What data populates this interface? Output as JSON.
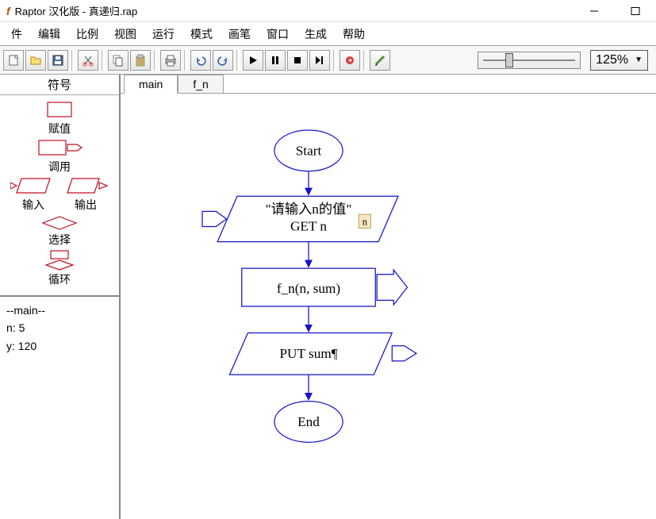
{
  "window": {
    "title": "Raptor 汉化版 - 真递归.rap",
    "logo_text": "f"
  },
  "menubar": {
    "items": [
      "件",
      "编辑",
      "比例",
      "视图",
      "运行",
      "模式",
      "画笔",
      "窗口",
      "生成",
      "帮助"
    ]
  },
  "toolbar": {
    "zoom_value": "125%"
  },
  "symbols": {
    "title": "符号",
    "assign": "赋值",
    "call": "调用",
    "input": "输入",
    "output": "输出",
    "select": "选择",
    "loop": "循环"
  },
  "watch": {
    "main_label": "--main--",
    "vars": [
      {
        "name": "n",
        "value": "5"
      },
      {
        "name": "y",
        "value": "120"
      }
    ]
  },
  "tabs": {
    "items": [
      "main",
      "f_n"
    ]
  },
  "flowchart": {
    "start_label": "Start",
    "end_label": "End",
    "input_prompt": "\"请输入n的值\"",
    "input_var": "GET n",
    "input_badge": "n",
    "call_text": "f_n(n, sum)",
    "output_text": "PUT sum¶"
  }
}
